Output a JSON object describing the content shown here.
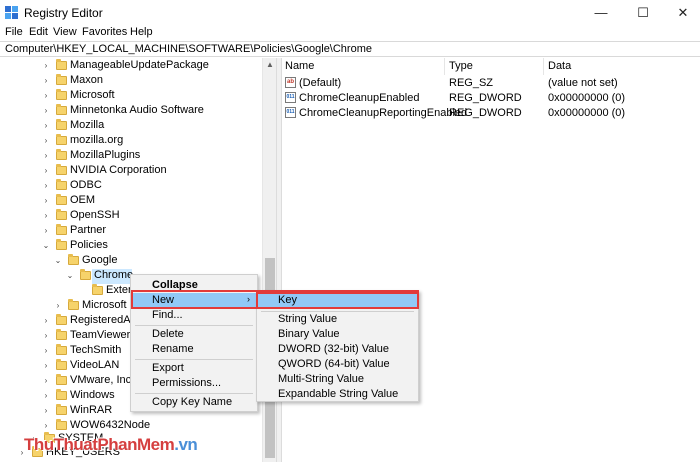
{
  "window": {
    "title": "Registry Editor",
    "controls": {
      "minimize": "—",
      "maximize": "☐",
      "close": "✕"
    }
  },
  "menu": [
    "File",
    "Edit",
    "View",
    "Favorites",
    "Help"
  ],
  "address": "Computer\\HKEY_LOCAL_MACHINE\\SOFTWARE\\Policies\\Google\\Chrome",
  "tree": {
    "items": [
      {
        "label": "ManageableUpdatePackage",
        "chevron": "›"
      },
      {
        "label": "Maxon",
        "chevron": "›"
      },
      {
        "label": "Microsoft",
        "chevron": "›"
      },
      {
        "label": "Minnetonka Audio Software",
        "chevron": "›"
      },
      {
        "label": "Mozilla",
        "chevron": "›"
      },
      {
        "label": "mozilla.org",
        "chevron": "›"
      },
      {
        "label": "MozillaPlugins",
        "chevron": "›"
      },
      {
        "label": "NVIDIA Corporation",
        "chevron": "›"
      },
      {
        "label": "ODBC",
        "chevron": "›"
      },
      {
        "label": "OEM",
        "chevron": "›"
      },
      {
        "label": "OpenSSH",
        "chevron": "›"
      },
      {
        "label": "Partner",
        "chevron": "›"
      },
      {
        "label": "Policies",
        "chevron": "⌄"
      },
      {
        "label": "Google",
        "chevron": "⌄"
      },
      {
        "label": "Chrome",
        "chevron": "⌄"
      },
      {
        "label": "Exten",
        "chevron": ""
      },
      {
        "label": "Microsoft",
        "chevron": "›"
      },
      {
        "label": "RegisteredApp",
        "chevron": "›"
      },
      {
        "label": "TeamViewer",
        "chevron": "›"
      },
      {
        "label": "TechSmith",
        "chevron": "›"
      },
      {
        "label": "VideoLAN",
        "chevron": "›"
      },
      {
        "label": "VMware, Inc.",
        "chevron": "›"
      },
      {
        "label": "Windows",
        "chevron": "›"
      },
      {
        "label": "WinRAR",
        "chevron": "›"
      },
      {
        "label": "WOW6432Node",
        "chevron": "›"
      },
      {
        "label": "SYSTEM",
        "chevron": "›"
      },
      {
        "label": "HKEY_USERS",
        "chevron": "›"
      }
    ]
  },
  "list": {
    "columns": [
      "Name",
      "Type",
      "Data"
    ],
    "rows": [
      {
        "icon": "ab",
        "name": "(Default)",
        "type": "REG_SZ",
        "data": "(value not set)"
      },
      {
        "icon": "011",
        "name": "ChromeCleanupEnabled",
        "type": "REG_DWORD",
        "data": "0x00000000 (0)"
      },
      {
        "icon": "011",
        "name": "ChromeCleanupReportingEnabled",
        "type": "REG_DWORD",
        "data": "0x00000000 (0)"
      }
    ]
  },
  "context_menu": {
    "items": [
      "Collapse",
      "New",
      "Find...",
      "Delete",
      "Rename",
      "Export",
      "Permissions...",
      "Copy Key Name"
    ],
    "submenu_arrow": "›"
  },
  "submenu": {
    "items": [
      "Key",
      "String Value",
      "Binary Value",
      "DWORD (32-bit) Value",
      "QWORD (64-bit) Value",
      "Multi-String Value",
      "Expandable String Value"
    ]
  },
  "watermark": {
    "main": "ThuThuatPhanMem",
    "suffix": ".vn"
  },
  "colors": {
    "selection": "#91c9f7",
    "highlight_frame": "#e23b3b",
    "folder": "#f6d36b"
  }
}
